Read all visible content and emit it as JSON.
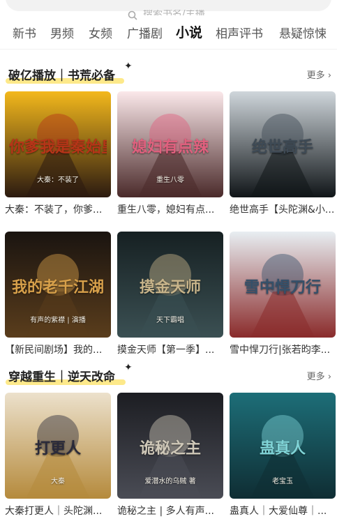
{
  "search": {
    "placeholder": "搜索书名/主播",
    "icon": "search-icon"
  },
  "tabs": [
    {
      "label": "新书",
      "active": false
    },
    {
      "label": "男频",
      "active": false
    },
    {
      "label": "女频",
      "active": false
    },
    {
      "label": "广播剧",
      "active": false
    },
    {
      "label": "小说",
      "active": true
    },
    {
      "label": "相声评书",
      "active": false
    },
    {
      "label": "悬疑惊悚",
      "active": false
    }
  ],
  "sections": [
    {
      "title": "破亿播放｜书荒必备",
      "more": "更多",
      "books": [
        {
          "title": "大秦：不装了，你爹...",
          "cover_text": "你爹我是秦始皇",
          "cover_sub": "大秦：不装了",
          "palette": [
            "#f3b81c",
            "#b63418",
            "#2b1a10"
          ]
        },
        {
          "title": "重生八零，媳妇有点...",
          "cover_text": "媳妇有点辣",
          "cover_sub": "重生八零",
          "palette": [
            "#fbe8ea",
            "#e0607e",
            "#4a2a2a"
          ]
        },
        {
          "title": "绝世高手【头陀渊&小...",
          "cover_text": "绝世高手",
          "cover_sub": "",
          "palette": [
            "#cfd6db",
            "#3e4a55",
            "#101518"
          ]
        }
      ]
    },
    {
      "title": "",
      "more": "",
      "books": [
        {
          "title": "【新民间剧场】我的...",
          "cover_text": "我的老千江湖",
          "cover_sub": "有声的紫襟 | 演播",
          "palette": [
            "#1a1410",
            "#d7a04a",
            "#5a3d1c"
          ]
        },
        {
          "title": "摸金天师【第一季】...",
          "cover_text": "摸金天师",
          "cover_sub": "天下霸唱",
          "palette": [
            "#162022",
            "#c8b48a",
            "#3b5053"
          ]
        },
        {
          "title": "雪中悍刀行|张若昀李...",
          "cover_text": "雪中悍刀行",
          "cover_sub": "",
          "palette": [
            "#e8eef2",
            "#35506a",
            "#8a2b2b"
          ]
        }
      ]
    },
    {
      "title": "穿越重生｜逆天改命",
      "more": "更多",
      "books": [
        {
          "title": "大秦打更人｜头陀渊...",
          "cover_text": "打更人",
          "cover_sub": "大秦",
          "palette": [
            "#ece1cc",
            "#2a2a3a",
            "#b58a3c"
          ]
        },
        {
          "title": "诡秘之主 | 多人有声...",
          "cover_text": "诡秘之主",
          "cover_sub": "爱潜水的乌贼 著",
          "palette": [
            "#1c1d22",
            "#cfc8b8",
            "#4a4c55"
          ]
        },
        {
          "title": "蛊真人｜大爱仙尊｜...",
          "cover_text": "蛊真人",
          "cover_sub": "老宝玉",
          "palette": [
            "#1d6e78",
            "#7fd3d6",
            "#0f2d33"
          ]
        }
      ]
    }
  ]
}
